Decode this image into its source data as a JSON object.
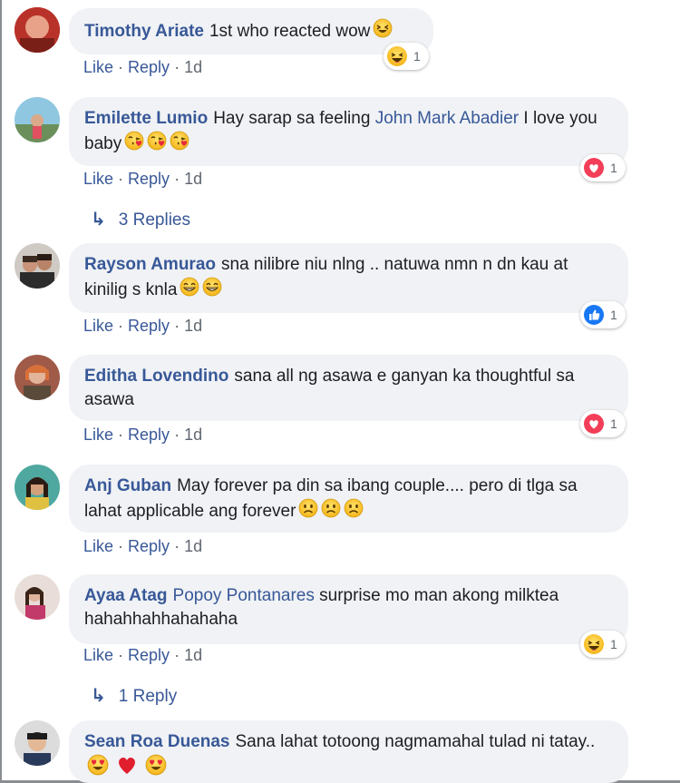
{
  "colors": {
    "link": "#385898",
    "meta": "#606770",
    "bubble": "#f0f2f5"
  },
  "comments": [
    {
      "author": "Timothy Ariate",
      "text": "1st who reacted wow",
      "emojis": [
        "laughing-sweat-emoji"
      ],
      "actions": {
        "like": "Like",
        "reply": "Reply",
        "time": "1d"
      },
      "reaction": {
        "icon": "haha-reaction-icon",
        "count": "1"
      }
    },
    {
      "author": "Emilette Lumio",
      "text_before": "Hay sarap sa feeling",
      "mention": "John Mark Abadier",
      "text_after": "I love you baby",
      "emojis": [
        "kiss-heart-emoji",
        "kiss-heart-emoji",
        "kiss-heart-emoji"
      ],
      "actions": {
        "like": "Like",
        "reply": "Reply",
        "time": "1d"
      },
      "reaction": {
        "icon": "love-reaction-icon",
        "count": "1"
      },
      "replies": {
        "icon": "reply-arrow-icon",
        "label": "3 Replies"
      }
    },
    {
      "author": "Rayson Amurao",
      "text": "sna nilibre niu nlng .. natuwa nmn n dn kau at kinilig s knla",
      "emojis": [
        "grinning-emoji",
        "grinning-emoji"
      ],
      "actions": {
        "like": "Like",
        "reply": "Reply",
        "time": "1d"
      },
      "reaction": {
        "icon": "like-reaction-icon",
        "count": "1"
      }
    },
    {
      "author": "Editha Lovendino",
      "text": "sana all ng asawa e ganyan ka thoughtful sa asawa",
      "actions": {
        "like": "Like",
        "reply": "Reply",
        "time": "1d"
      },
      "reaction": {
        "icon": "love-reaction-icon",
        "count": "1"
      }
    },
    {
      "author": "Anj Guban",
      "text": "May forever pa din sa ibang couple.... pero di tlga sa lahat applicable ang forever",
      "emojis": [
        "sad-emoji",
        "sad-emoji",
        "sad-emoji"
      ],
      "actions": {
        "like": "Like",
        "reply": "Reply",
        "time": "1d"
      }
    },
    {
      "author": "Ayaa Atag",
      "mention": "Popoy Pontanares",
      "text_after": "surprise mo man akong milktea hahahhahhahahaha",
      "actions": {
        "like": "Like",
        "reply": "Reply",
        "time": "1d"
      },
      "reaction": {
        "icon": "haha-reaction-icon",
        "count": "1"
      },
      "replies": {
        "icon": "reply-arrow-icon",
        "label": "1 Reply"
      }
    },
    {
      "author": "Sean Roa Duenas",
      "text": "Sana lahat totoong nagmamahal tulad ni tatay..",
      "emojis": [
        "heart-eyes-emoji",
        "red-heart-emoji",
        "heart-eyes-emoji"
      ]
    }
  ]
}
